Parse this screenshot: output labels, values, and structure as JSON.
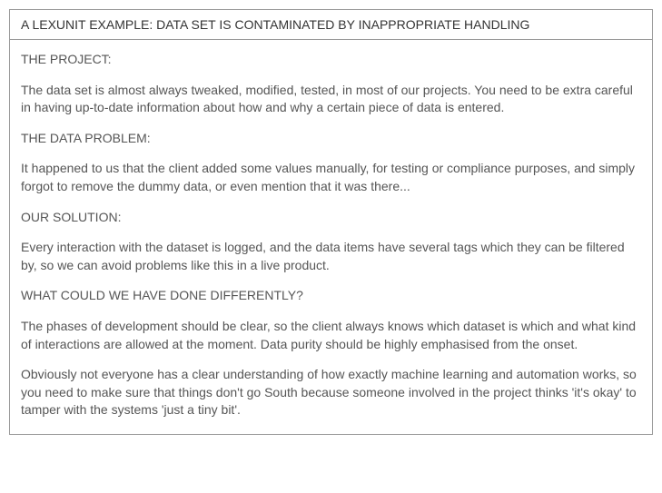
{
  "title": "A LEXUNIT EXAMPLE: DATA SET IS CONTAMINATED BY INAPPROPRIATE HANDLING",
  "sections": [
    {
      "heading": "THE PROJECT:",
      "paragraphs": [
        "The data set is almost always tweaked, modified, tested, in most of our projects. You need to be extra careful in having up-to-date information about how and why a certain piece of data is entered."
      ]
    },
    {
      "heading": "THE DATA PROBLEM:",
      "paragraphs": [
        "It happened to us that the client added some values manually, for testing or compliance purposes, and simply forgot to remove the dummy data, or even mention that it was there..."
      ]
    },
    {
      "heading": "OUR SOLUTION:",
      "paragraphs": [
        "Every interaction with the dataset is logged, and the data items have several tags which they can be filtered by, so we can avoid problems like this in a live product."
      ]
    },
    {
      "heading": "WHAT COULD WE HAVE DONE DIFFERENTLY?",
      "paragraphs": [
        "The phases of development should be clear, so the client always knows which dataset is which and what kind of interactions are allowed at the moment. Data purity should be highly emphasised from the onset.",
        "Obviously not everyone has a clear understanding of how exactly machine learning and automation works, so you need to make sure that things don't go South because someone involved in the project thinks 'it's okay' to tamper with the systems 'just a tiny bit'."
      ]
    }
  ]
}
